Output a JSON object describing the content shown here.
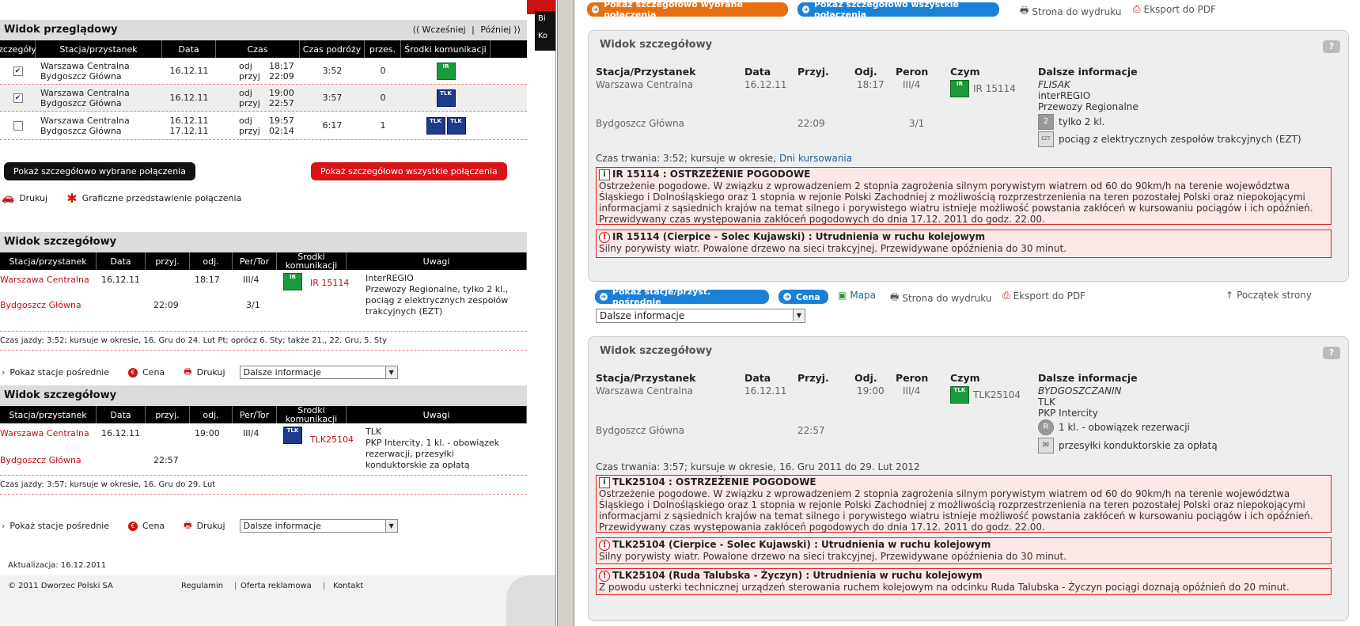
{
  "left": {
    "overview": {
      "title": "Widok przeglądowy",
      "earlier": "⟨⟨ Wcześniej",
      "later": "Później ⟩⟩",
      "sep": "|",
      "headers": [
        "zczegóły",
        "Stacja/przystanek",
        "Data",
        "Czas",
        "Czas podróży",
        "przes.",
        "Środki komunikacji"
      ],
      "rows": [
        {
          "checked": true,
          "from": "Warszawa Centralna",
          "to": "Bydgoszcz Główna",
          "date1": "16.12.11",
          "date2": "",
          "dep_label": "odj",
          "dep": "18:17",
          "arr_label": "przyj",
          "arr": "22:09",
          "duration": "3:52",
          "changes": "0",
          "icon": "IR"
        },
        {
          "checked": true,
          "from": "Warszawa Centralna",
          "to": "Bydgoszcz Główna",
          "date1": "16.12.11",
          "date2": "",
          "dep_label": "odj",
          "dep": "19:00",
          "arr_label": "przyj",
          "arr": "22:57",
          "duration": "3:57",
          "changes": "0",
          "icon": "TLK"
        },
        {
          "checked": false,
          "from": "Warszawa Centralna",
          "to": "Bydgoszcz Główna",
          "date1": "16.12.11",
          "date2": "17.12.11",
          "dep_label": "odj",
          "dep": "19:57",
          "arr_label": "przyj",
          "arr": "02:14",
          "duration": "6:17",
          "changes": "1",
          "icon": "TLK TLK"
        }
      ],
      "btn_selected": "Pokaż szczegółowo wybrane połączenia",
      "btn_all": "Pokaż szczegółowo wszystkie połączenia",
      "print": "Drukuj",
      "graphic": "Graficzne przedstawienie połączenia"
    },
    "details": [
      {
        "title": "Widok szczegółowy",
        "headers": [
          "Stacja/przystanek",
          "Data",
          "przyj.",
          "odj.",
          "Per/Tor",
          "Środki komunikacji",
          "Uwagi"
        ],
        "from": "Warszawa Centralna",
        "date": "16.12.11",
        "dep": "18:17",
        "platform1": "III/4",
        "train": "IR 15114",
        "icon": "IR",
        "to": "Bydgoszcz Główna",
        "arr": "22:09",
        "platform2": "3/1",
        "notes": "InterREGIO\nPrzewozy Regionalne, tylko 2 kl., pociąg z elektrycznych zespołów trakcyjnych (EZT)",
        "summary": "Czas jazdy: 3:52; kursuje w okresie, 16. Gru do 24. Lut Pt; oprócz 6. Sty; także 21., 22. Gru, 5. Sty"
      },
      {
        "title": "Widok szczegółowy",
        "headers": [
          "Stacja/przystanek",
          "Data",
          "przyj.",
          "odj.",
          "Per/Tor",
          "Środki komunikacji",
          "Uwagi"
        ],
        "from": "Warszawa Centralna",
        "date": "16.12.11",
        "dep": "19:00",
        "platform1": "III/4",
        "train": "TLK25104",
        "icon": "TLK",
        "to": "Bydgoszcz Główna",
        "arr": "22:57",
        "platform2": "",
        "notes": "TLK\nPKP Intercity, 1 kl. - obowiązek rezerwacji, przesyłki konduktorskie za opłatą",
        "summary": "Czas jazdy: 3:57; kursuje w okresie, 16. Gru do 29. Lut"
      }
    ],
    "controls": {
      "stations": "Pokaż stacje pośrednie",
      "price": "Cena",
      "print": "Drukuj",
      "more": "Dalsze informacje"
    },
    "updated": "Aktualizacja: 16.12.2011",
    "footer": {
      "copyright": "© 2011 Dworzec Polski SA",
      "links": [
        "Regulamin",
        "Oferta reklamowa",
        "Kontakt"
      ]
    }
  },
  "right": {
    "top": {
      "btn_selected": "Pokaż szczegółowo wybrane połączenia",
      "btn_all": "Pokaż szczegółowo wszystkie połączenia",
      "print": "Strona do wydruku",
      "pdf": "Eksport do PDF"
    },
    "panels": [
      {
        "title": "Widok szczegółowy",
        "help": "?",
        "headers": [
          "Stacja/Przystanek",
          "Data",
          "Przyj.",
          "Odj.",
          "Peron",
          "Czym",
          "Dalsze informacje"
        ],
        "from": "Warszawa Centralna",
        "date": "16.12.11",
        "dep": "18:17",
        "peron1": "III/4",
        "train": "IR 15114",
        "icon": "IR",
        "info_name": "FLISAK",
        "info_cat": "interREGIO",
        "info_op": "Przewozy Regionalne",
        "attr1_icon": "2",
        "attr1": "tylko 2 kl.",
        "attr2_icon": "EZT",
        "attr2": "pociąg z elektrycznych zespołów trakcyjnych (EZT)",
        "to": "Bydgoszcz Główna",
        "arr": "22:09",
        "peron2": "3/1",
        "duration": "Czas trwania: 3:52; kursuje w okresie,",
        "duration_link": "Dni kursowania",
        "warnings": [
          {
            "icon": "i",
            "title": "IR 15114  : OSTRZEŻENIE POGODOWE",
            "text": "Ostrzeżenie pogodowe. W związku z wprowadzeniem 2 stopnia zagrożenia silnym porywistym wiatrem od 60 do 90km/h na terenie województwa Śląskiego i Dolnośląskiego oraz 1 stopnia w rejonie Polski Zachodniej z możliwością rozprzestrzenienia na teren pozostałej Polski oraz niepokojącymi informacjami z sąsiednich krajów na temat silnego i porywistego wiatru istnieje możliwość powstania zakłóceń w kursowaniu pociągów i ich opóźnień. Przewidywany czas występowania zakłóceń pogodowych do dnia 17.12. 2011 do godz. 22.00."
          },
          {
            "icon": "!",
            "title": "IR 15114  (Cierpice - Solec Kujawski) : Utrudnienia w ruchu kolejowym",
            "text": "Silny porywisty wiatr. Powalone drzewo na sieci trakcyjnej. Przewidywane opóźnienia do 30 minut."
          }
        ]
      },
      {
        "title": "Widok szczegółowy",
        "help": "?",
        "headers": [
          "Stacja/Przystanek",
          "Data",
          "Przyj.",
          "Odj.",
          "Peron",
          "Czym",
          "Dalsze informacje"
        ],
        "from": "Warszawa Centralna",
        "date": "16.12.11",
        "dep": "19:00",
        "peron1": "III/4",
        "train": "TLK25104",
        "icon": "TLK",
        "info_name": "BYDGOSZCZANIN",
        "info_cat": "TLK",
        "info_op": "PKP Intercity",
        "attr1_icon": "R",
        "attr1": "1 kl. - obowiązek rezerwacji",
        "attr2_icon": "✉",
        "attr2": "przesyłki konduktorskie za opłatą",
        "to": "Bydgoszcz Główna",
        "arr": "22:57",
        "peron2": "",
        "duration": "Czas trwania: 3:57; kursuje w okresie, 16. Gru 2011 do 29. Lut 2012",
        "duration_link": "",
        "warnings": [
          {
            "icon": "i",
            "title": "TLK25104  : OSTRZEŻENIE POGODOWE",
            "text": "Ostrzeżenie pogodowe. W związku z wprowadzeniem 2 stopnia zagrożenia silnym porywistym wiatrem od 60 do 90km/h na terenie województwa Śląskiego i Dolnośląskiego oraz 1 stopnia w rejonie Polski Zachodniej z możliwością rozprzestrzenienia na teren pozostałej Polski oraz niepokojącymi informacjami z sąsiednich krajów na temat silnego i porywistego wiatru istnieje możliwość powstania zakłóceń w kursowaniu pociągów i ich opóźnień. Przewidywany czas występowania zakłóceń pogodowych do dnia 17.12. 2011 do godz. 22.00."
          },
          {
            "icon": "!",
            "title": "TLK25104  (Cierpice - Solec Kujawski) : Utrudnienia w ruchu kolejowym",
            "text": "Silny porywisty wiatr. Powalone drzewo na sieci trakcyjnej. Przewidywane opóźnienia do 30 minut."
          },
          {
            "icon": "!",
            "title": "TLK25104  (Ruda Talubska - Życzyn) : Utrudnienia w ruchu kolejowym",
            "text": "Z powodu usterki technicznej urządzeń sterowania ruchem kolejowym na odcinku Ruda Talubska - Życzyn pociągi doznają opóźnień do 20 minut."
          }
        ]
      }
    ],
    "mid": {
      "stations": "Pokaż stacje/przyst. pośrednie",
      "price": "Cena",
      "map": "Mapa",
      "print": "Strona do wydruku",
      "pdf": "Eksport do PDF",
      "top": "Początek strony",
      "select": "Dalsze informacje"
    }
  },
  "colors": {
    "red": "#d8141a",
    "orange": "#e86e10",
    "blue": "#1a80d8",
    "warnborder": "#dd2222",
    "warnbg": "#fde8e8"
  }
}
